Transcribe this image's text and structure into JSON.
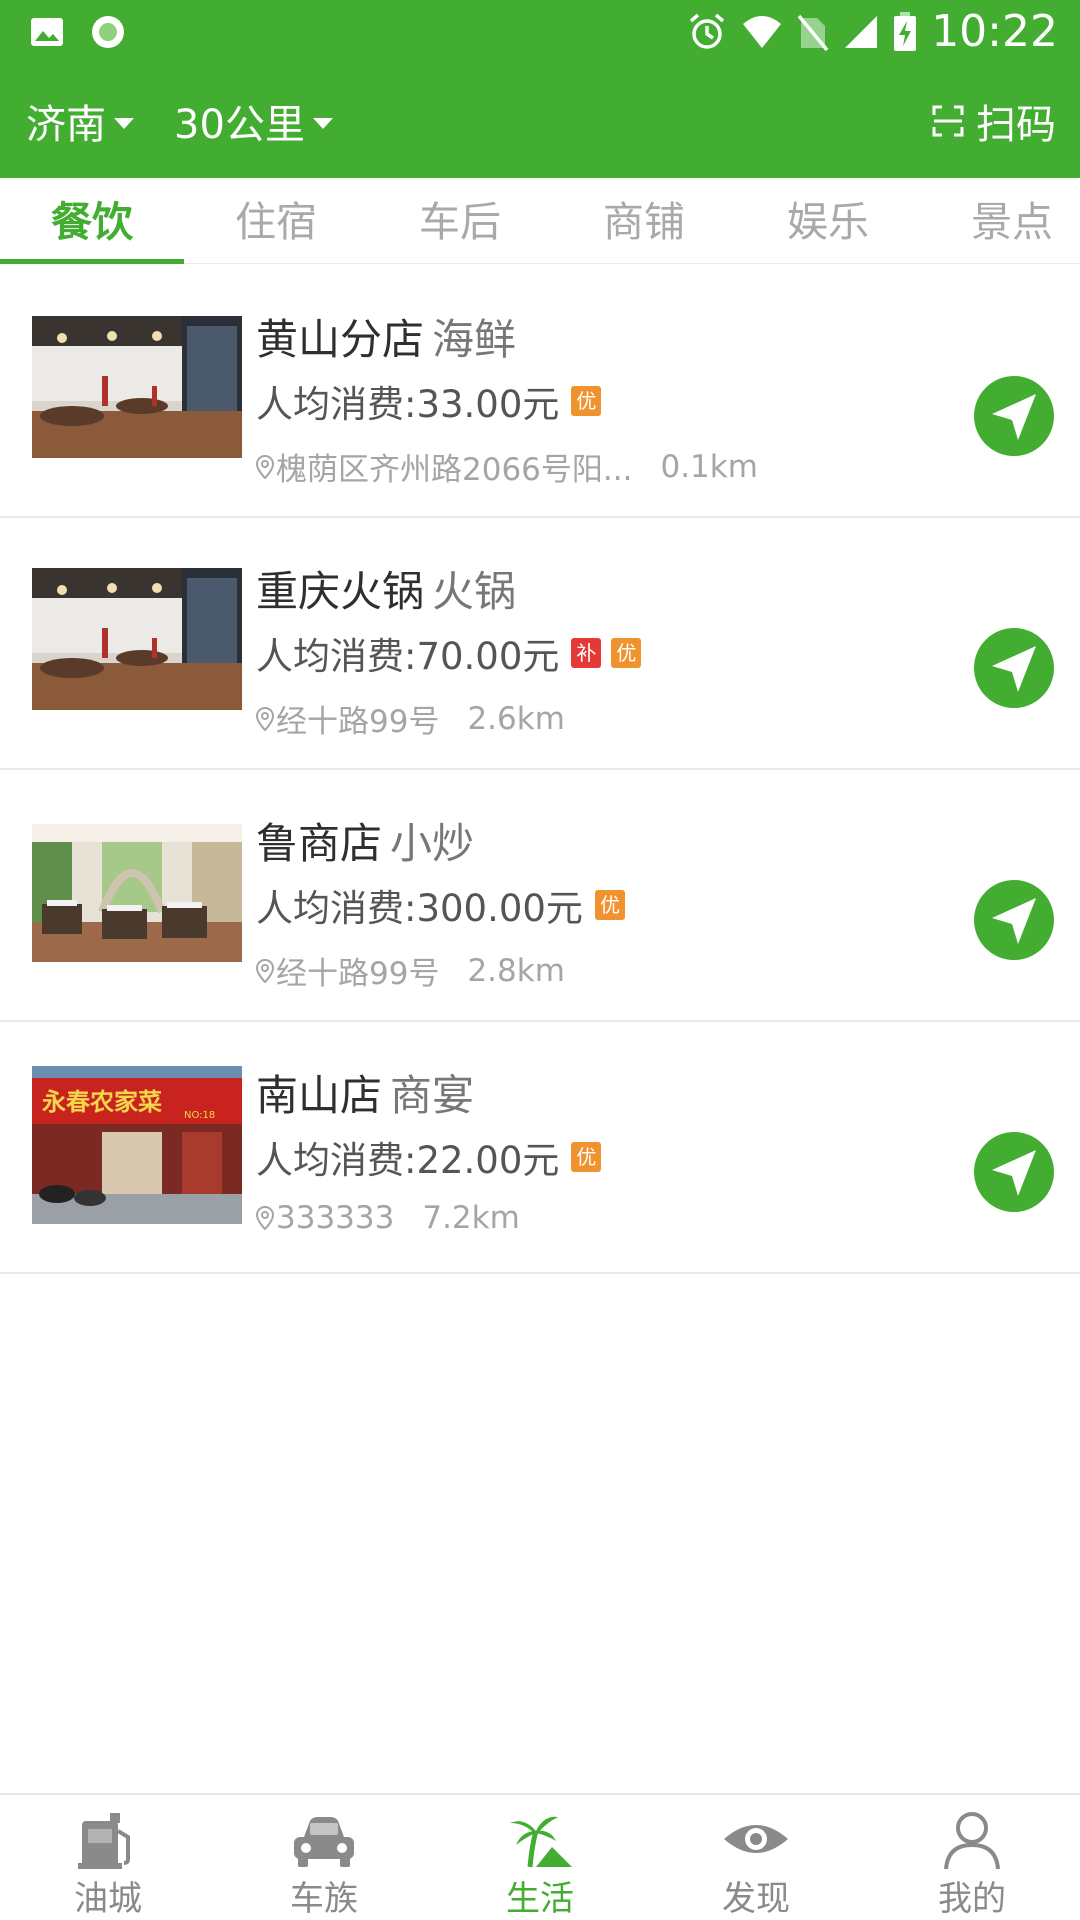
{
  "status_bar": {
    "time": "10:22",
    "left_icons": [
      "image-icon",
      "circle-dot-icon"
    ],
    "right_icons": [
      "alarm-icon",
      "wifi-icon",
      "no-sim-icon",
      "signal-icon",
      "battery-charging-icon"
    ]
  },
  "header": {
    "city": "济南",
    "distance_filter": "30公里",
    "scan_label": "扫码",
    "color": "#43ad32"
  },
  "tabs": [
    {
      "label": "餐饮",
      "active": true
    },
    {
      "label": "住宿",
      "active": false
    },
    {
      "label": "车后",
      "active": false
    },
    {
      "label": "商铺",
      "active": false
    },
    {
      "label": "娱乐",
      "active": false
    },
    {
      "label": "景点",
      "active": false
    }
  ],
  "stores": [
    {
      "name": "黄山分店",
      "category": "海鲜",
      "price": "人均消费:33.00元",
      "badges": [
        "优"
      ],
      "address": "槐荫区齐州路2066号阳...",
      "distance": "0.1km",
      "image": "restaurant-interior-photo"
    },
    {
      "name": "重庆火锅",
      "category": "火锅",
      "price": "人均消费:70.00元",
      "badges": [
        "补",
        "优"
      ],
      "address": "经十路99号",
      "distance": "2.6km",
      "image": "restaurant-interior-photo"
    },
    {
      "name": "鲁商店",
      "category": "小炒",
      "price": "人均消费:300.00元",
      "badges": [
        "优"
      ],
      "address": "经十路99号",
      "distance": "2.8km",
      "image": "dining-hall-photo"
    },
    {
      "name": "南山店",
      "category": "商宴",
      "price": "人均消费:22.00元",
      "badges": [
        "优"
      ],
      "address": "333333",
      "distance": "7.2km",
      "image": "storefront-photo"
    }
  ],
  "storefront_sign": "永春农家菜",
  "storefront_sign_no": "NO:18",
  "badge_colors": {
    "补": "#e53935",
    "优": "#f0922e"
  },
  "bottom_nav": [
    {
      "label": "油城",
      "icon": "fuel-pump-icon",
      "active": false
    },
    {
      "label": "车族",
      "icon": "car-icon",
      "active": false
    },
    {
      "label": "生活",
      "icon": "palm-tree-icon",
      "active": true
    },
    {
      "label": "发现",
      "icon": "eye-icon",
      "active": false
    },
    {
      "label": "我的",
      "icon": "person-icon",
      "active": false
    }
  ]
}
